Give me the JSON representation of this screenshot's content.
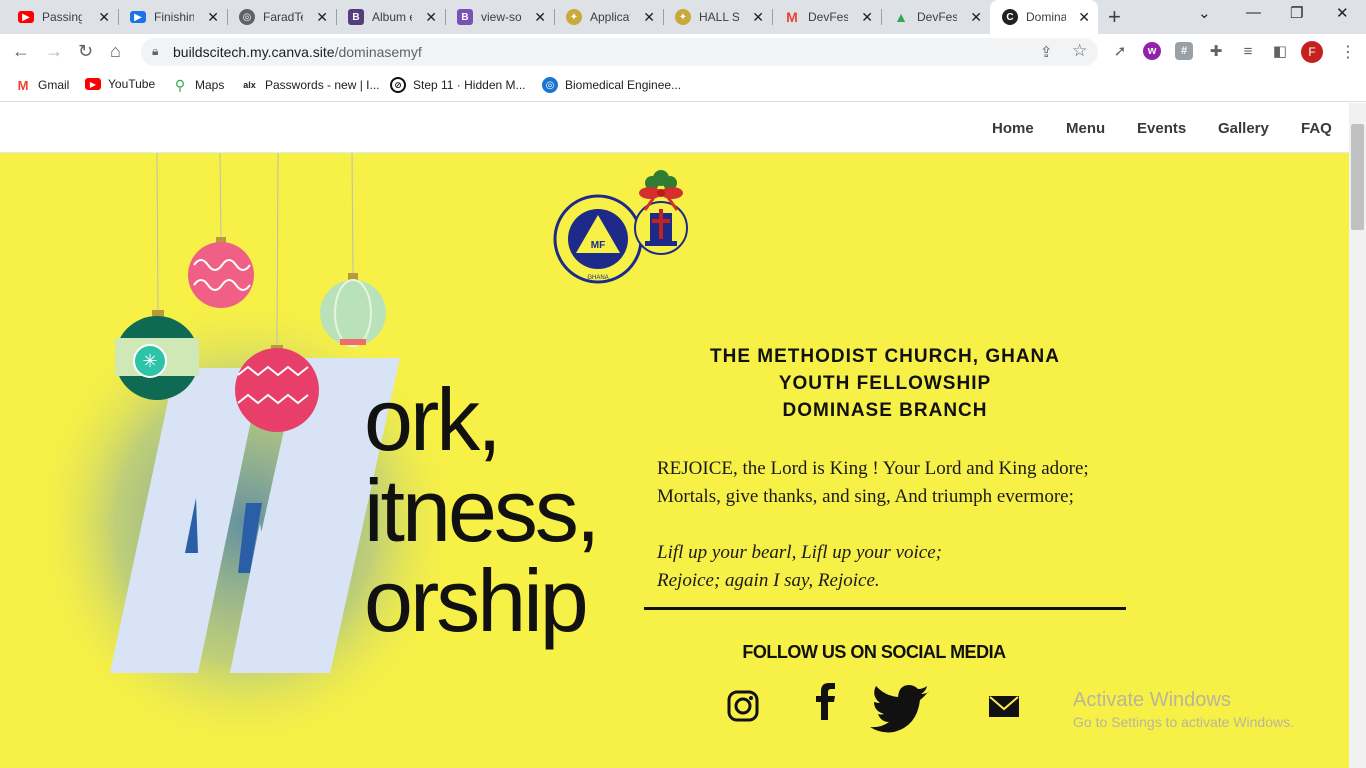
{
  "browser": {
    "tabs": [
      {
        "title": "Passing",
        "icon": "youtube-icon",
        "color": "#ff0000"
      },
      {
        "title": "Finishing",
        "icon": "video-icon",
        "color": "#1a73e8"
      },
      {
        "title": "FaradTec",
        "icon": "globe-icon",
        "color": "#5f6368"
      },
      {
        "title": "Album e",
        "icon": "bootstrap-icon",
        "color": "#563d7c"
      },
      {
        "title": "view-sou",
        "icon": "bootstrap-icon",
        "color": "#7952b3"
      },
      {
        "title": "Applicat",
        "icon": "crest-icon",
        "color": "#8a6d1a"
      },
      {
        "title": "HALL SE",
        "icon": "crest-icon",
        "color": "#8a6d1a"
      },
      {
        "title": "DevFest",
        "icon": "gmail-icon",
        "color": "#ea4335"
      },
      {
        "title": "DevFest",
        "icon": "drive-icon",
        "color": "#34a853"
      },
      {
        "title": "Domina",
        "icon": "canva-icon",
        "color": "#202124"
      }
    ],
    "url_host": "buildscitech.my.canva.site",
    "url_path": "/dominasemyf",
    "avatar_letter": "F",
    "bookmarks": [
      {
        "label": "Gmail",
        "icon": "gmail-icon"
      },
      {
        "label": "YouTube",
        "icon": "youtube-icon"
      },
      {
        "label": "Maps",
        "icon": "maps-icon"
      },
      {
        "label": "Passwords - new | I...",
        "icon": "alx-icon"
      },
      {
        "label": "Step 11 · Hidden M...",
        "icon": "github-icon"
      },
      {
        "label": "Biomedical Enginee...",
        "icon": "globe-icon"
      }
    ]
  },
  "site": {
    "nav": [
      "Home",
      "Menu",
      "Events",
      "Gallery",
      "FAQ"
    ],
    "big_words": [
      "ork,",
      "itness,",
      "orship"
    ],
    "big_letter": "W",
    "heading": [
      "THE METHODIST CHURCH, GHANA",
      "YOUTH FELLOWSHIP",
      "DOMINASE BRANCH"
    ],
    "verse_lines": [
      "REJOICE, the Lord is King ! Your Lord and King adore;",
      "Mortals, give thanks, and sing, And triumph evermore;",
      "Lifl up your bearl, Lifl up your voice;",
      "Rejoice; again I say, Rejoice."
    ],
    "follow_text": "FOLLOW US ON SOCIAL MEDIA",
    "social": [
      "instagram-icon",
      "facebook-icon",
      "twitter-icon",
      "email-icon"
    ],
    "logo_text": {
      "mf_top": "METHODIST YOUTH FELLOWSHIP",
      "mf_center": "MF",
      "mf_bottom": "GHANA",
      "church": "THE METHODIST CHURCH GHANA"
    },
    "colors": {
      "background": "#f7f046",
      "text": "#111111"
    }
  },
  "windows_watermark": {
    "title": "Activate Windows",
    "subtitle": "Go to Settings to activate Windows."
  }
}
